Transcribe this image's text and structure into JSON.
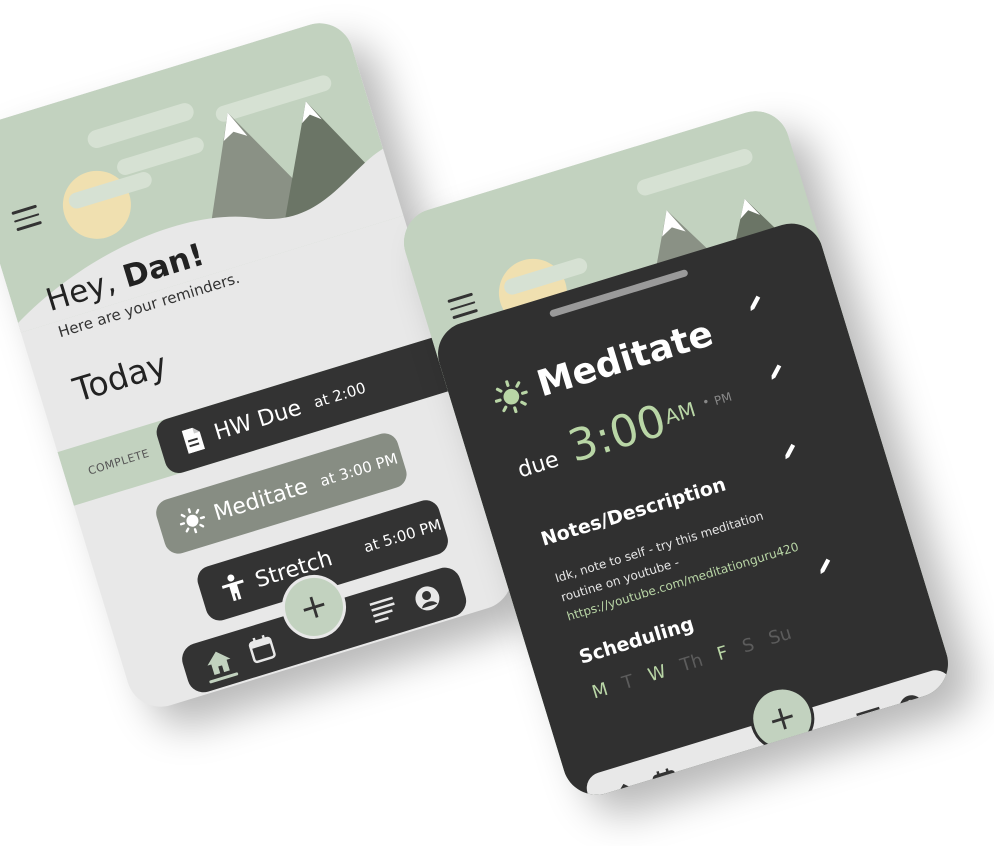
{
  "colors": {
    "sage": "#c2d2bf",
    "dark": "#303030",
    "light": "#e8e8e8",
    "accent_green": "#b9d6a6",
    "sun": "#f0e0b0",
    "mountain_dark": "#6b7566",
    "mountain_mid": "#8a9185"
  },
  "phone1": {
    "greeting_prefix": "Hey, ",
    "greeting_name": "Dan!",
    "subtitle": "Here are your reminders.",
    "section_title": "Today",
    "complete_label": "COMPLETE",
    "reminders": [
      {
        "icon": "document-icon",
        "title": "HW Due",
        "time": "at 2:00"
      },
      {
        "icon": "sun-icon",
        "title": "Meditate",
        "time": "at 3:00 PM"
      },
      {
        "icon": "person-stretch-icon",
        "title": "Stretch",
        "time": "at 5:00 PM"
      }
    ],
    "fab_symbol": "+"
  },
  "phone2": {
    "title": "Meditate",
    "due_label": "due",
    "time": "3:00",
    "am": "AM",
    "dot": "•",
    "pm": "PM",
    "notes_label": "Notes/Description",
    "notes_text": "Idk, note to self - try this meditation routine on youtube - ",
    "notes_link": "https://youtube.com/meditationguru420",
    "scheduling_label": "Scheduling",
    "days": [
      {
        "label": "M",
        "active": true
      },
      {
        "label": "T",
        "active": false
      },
      {
        "label": "W",
        "active": true
      },
      {
        "label": "Th",
        "active": false
      },
      {
        "label": "F",
        "active": true
      },
      {
        "label": "S",
        "active": false
      },
      {
        "label": "Su",
        "active": false
      }
    ],
    "fab_symbol": "+"
  }
}
